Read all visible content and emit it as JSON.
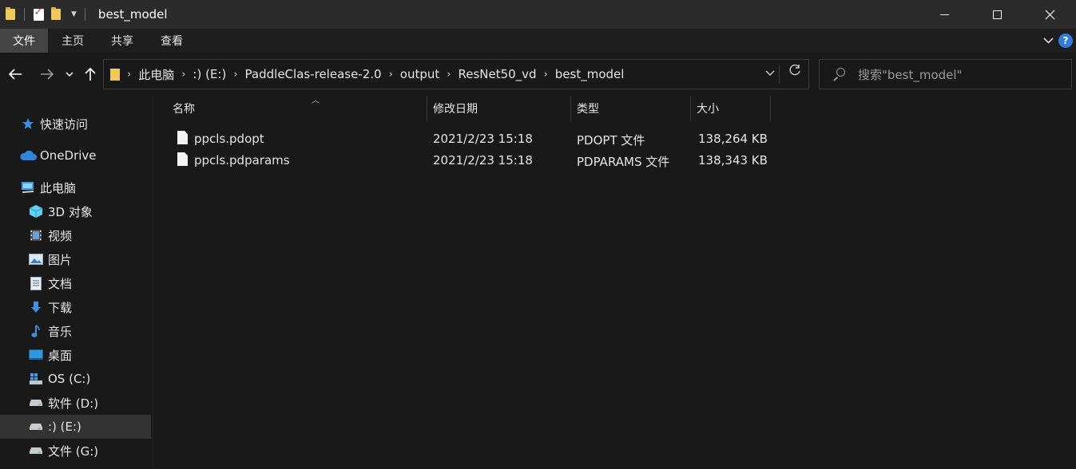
{
  "window": {
    "title": "best_model"
  },
  "ribbon": {
    "tabs": [
      "文件",
      "主页",
      "共享",
      "查看"
    ]
  },
  "address": {
    "crumbs": [
      "此电脑",
      ":) (E:)",
      "PaddleClas-release-2.0",
      "output",
      "ResNet50_vd",
      "best_model"
    ]
  },
  "search": {
    "placeholder": "搜索\"best_model\""
  },
  "sidebar": {
    "items": [
      {
        "label": "快速访问",
        "icon": "star-icon"
      },
      {
        "label": "OneDrive",
        "icon": "cloud-icon"
      },
      {
        "label": "此电脑",
        "icon": "computer-icon"
      },
      {
        "label": "3D 对象",
        "icon": "cube-icon"
      },
      {
        "label": "视频",
        "icon": "video-icon"
      },
      {
        "label": "图片",
        "icon": "picture-icon"
      },
      {
        "label": "文档",
        "icon": "document-icon"
      },
      {
        "label": "下载",
        "icon": "download-icon"
      },
      {
        "label": "音乐",
        "icon": "music-icon"
      },
      {
        "label": "桌面",
        "icon": "desktop-icon"
      },
      {
        "label": "OS (C:)",
        "icon": "windows-drive-icon"
      },
      {
        "label": "软件 (D:)",
        "icon": "drive-icon"
      },
      {
        "label": ":) (E:)",
        "icon": "drive-icon",
        "selected": true
      },
      {
        "label": "文件 (G:)",
        "icon": "drive-icon"
      }
    ]
  },
  "columns": {
    "name": "名称",
    "modified": "修改日期",
    "type": "类型",
    "size": "大小"
  },
  "files": [
    {
      "name": "ppcls.pdopt",
      "modified": "2021/2/23 15:18",
      "type": "PDOPT 文件",
      "size": "138,264 KB"
    },
    {
      "name": "ppcls.pdparams",
      "modified": "2021/2/23 15:18",
      "type": "PDPARAMS 文件",
      "size": "138,343 KB"
    }
  ],
  "colors": {
    "background": "#191919",
    "titlebar": "#2b2b2b",
    "folder": "#f1c95b",
    "accent": "#2f7fd8",
    "selected": "#333333"
  }
}
